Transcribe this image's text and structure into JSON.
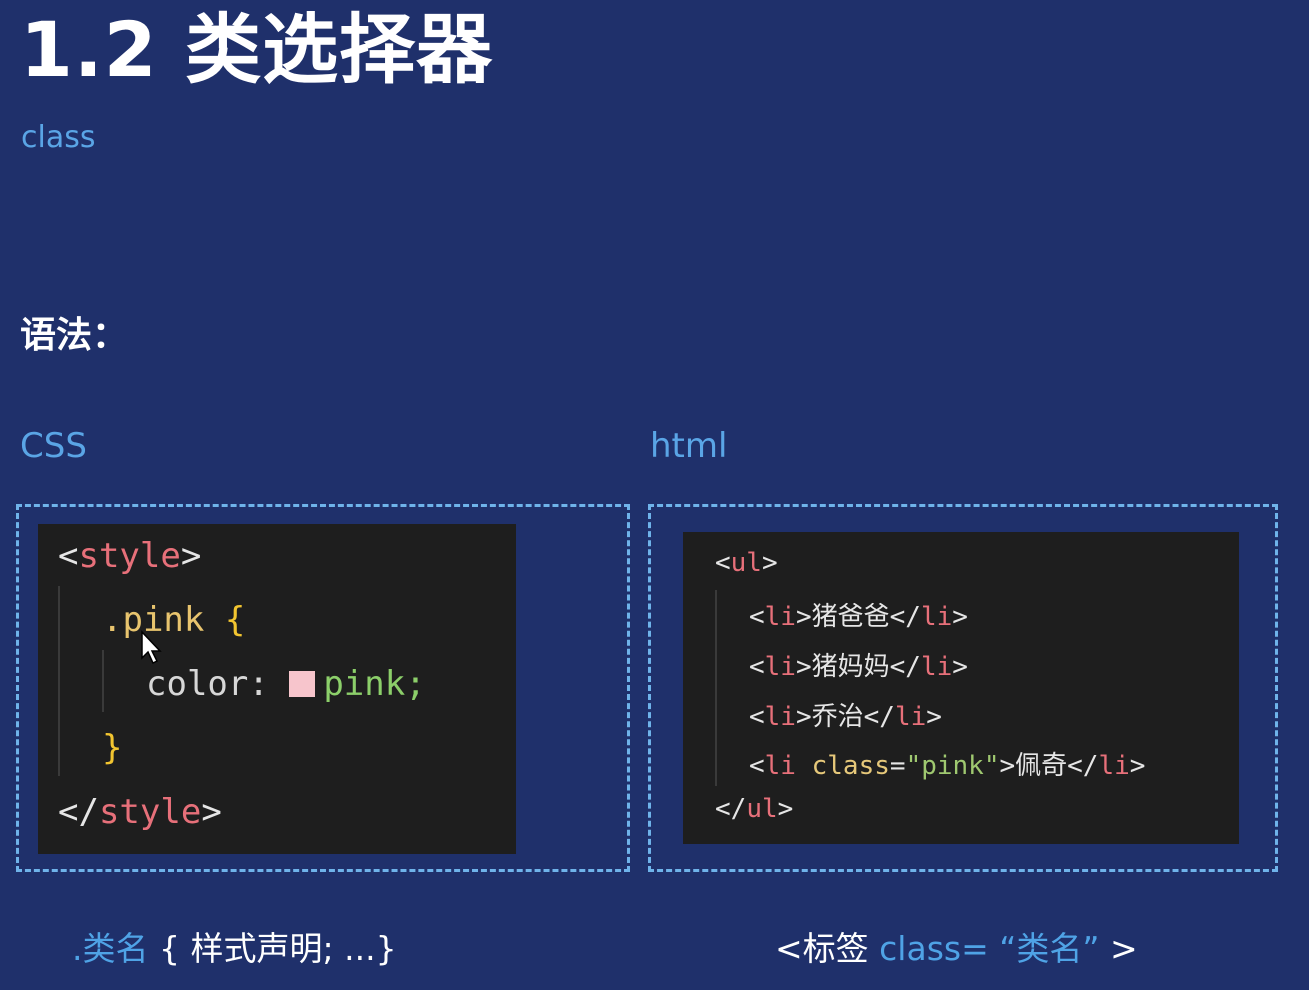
{
  "slide": {
    "title": "1.2 类选择器",
    "subtitle": "class",
    "syntax_label": "语法：",
    "css_label": "CSS",
    "html_label": "html"
  },
  "css_code": {
    "open_bracket": "<",
    "open_tag": "style",
    "close_bracket": ">",
    "selector": ".pink",
    "brace_open": "{",
    "property": "color:",
    "value": "pink;",
    "swatch_color": "#f7c5cc",
    "brace_close": "}",
    "close_open_bracket": "</",
    "close_tag": "style",
    "close_close_bracket": ">"
  },
  "html_code": {
    "ul_open": "ul",
    "ul_close": "ul",
    "li_tag": "li",
    "items": [
      {
        "text": "猪爸爸"
      },
      {
        "text": "猪妈妈"
      },
      {
        "text": "乔治"
      },
      {
        "text": "佩奇",
        "class_attr": "class",
        "class_value": "\"pink\""
      }
    ]
  },
  "footer": {
    "css_selector": ".类名",
    "css_rest": "{ 样式声明; ...}",
    "html_open": "<标签",
    "html_class": "class=",
    "html_value": "“类名”",
    "html_close": ">"
  }
}
